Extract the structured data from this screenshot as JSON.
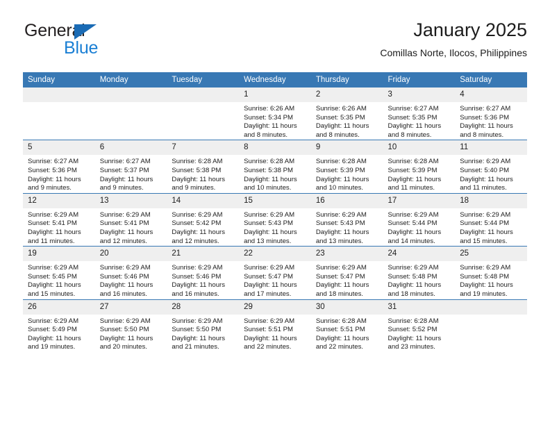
{
  "brand": {
    "name_top": "General",
    "name_bottom": "Blue",
    "triangle_icon": "triangle-icon",
    "color_dark": "#231f20",
    "color_blue": "#1a7fd4"
  },
  "header": {
    "title": "January 2025",
    "subtitle": "Comillas Norte, Ilocos, Philippines"
  },
  "theme": {
    "header_bg": "#3878b4",
    "header_text": "#ffffff",
    "daynum_bg": "#efefef",
    "cell_border": "#3878b4"
  },
  "calendar": {
    "weekdays": [
      "Sunday",
      "Monday",
      "Tuesday",
      "Wednesday",
      "Thursday",
      "Friday",
      "Saturday"
    ],
    "weeks": [
      [
        {
          "day": "",
          "sunrise": "",
          "sunset": "",
          "daylight": "",
          "empty": true
        },
        {
          "day": "",
          "sunrise": "",
          "sunset": "",
          "daylight": "",
          "empty": true
        },
        {
          "day": "",
          "sunrise": "",
          "sunset": "",
          "daylight": "",
          "empty": true
        },
        {
          "day": "1",
          "sunrise": "Sunrise: 6:26 AM",
          "sunset": "Sunset: 5:34 PM",
          "daylight": "Daylight: 11 hours and 8 minutes.",
          "empty": false
        },
        {
          "day": "2",
          "sunrise": "Sunrise: 6:26 AM",
          "sunset": "Sunset: 5:35 PM",
          "daylight": "Daylight: 11 hours and 8 minutes.",
          "empty": false
        },
        {
          "day": "3",
          "sunrise": "Sunrise: 6:27 AM",
          "sunset": "Sunset: 5:35 PM",
          "daylight": "Daylight: 11 hours and 8 minutes.",
          "empty": false
        },
        {
          "day": "4",
          "sunrise": "Sunrise: 6:27 AM",
          "sunset": "Sunset: 5:36 PM",
          "daylight": "Daylight: 11 hours and 8 minutes.",
          "empty": false
        }
      ],
      [
        {
          "day": "5",
          "sunrise": "Sunrise: 6:27 AM",
          "sunset": "Sunset: 5:36 PM",
          "daylight": "Daylight: 11 hours and 9 minutes.",
          "empty": false
        },
        {
          "day": "6",
          "sunrise": "Sunrise: 6:27 AM",
          "sunset": "Sunset: 5:37 PM",
          "daylight": "Daylight: 11 hours and 9 minutes.",
          "empty": false
        },
        {
          "day": "7",
          "sunrise": "Sunrise: 6:28 AM",
          "sunset": "Sunset: 5:38 PM",
          "daylight": "Daylight: 11 hours and 9 minutes.",
          "empty": false
        },
        {
          "day": "8",
          "sunrise": "Sunrise: 6:28 AM",
          "sunset": "Sunset: 5:38 PM",
          "daylight": "Daylight: 11 hours and 10 minutes.",
          "empty": false
        },
        {
          "day": "9",
          "sunrise": "Sunrise: 6:28 AM",
          "sunset": "Sunset: 5:39 PM",
          "daylight": "Daylight: 11 hours and 10 minutes.",
          "empty": false
        },
        {
          "day": "10",
          "sunrise": "Sunrise: 6:28 AM",
          "sunset": "Sunset: 5:39 PM",
          "daylight": "Daylight: 11 hours and 11 minutes.",
          "empty": false
        },
        {
          "day": "11",
          "sunrise": "Sunrise: 6:29 AM",
          "sunset": "Sunset: 5:40 PM",
          "daylight": "Daylight: 11 hours and 11 minutes.",
          "empty": false
        }
      ],
      [
        {
          "day": "12",
          "sunrise": "Sunrise: 6:29 AM",
          "sunset": "Sunset: 5:41 PM",
          "daylight": "Daylight: 11 hours and 11 minutes.",
          "empty": false
        },
        {
          "day": "13",
          "sunrise": "Sunrise: 6:29 AM",
          "sunset": "Sunset: 5:41 PM",
          "daylight": "Daylight: 11 hours and 12 minutes.",
          "empty": false
        },
        {
          "day": "14",
          "sunrise": "Sunrise: 6:29 AM",
          "sunset": "Sunset: 5:42 PM",
          "daylight": "Daylight: 11 hours and 12 minutes.",
          "empty": false
        },
        {
          "day": "15",
          "sunrise": "Sunrise: 6:29 AM",
          "sunset": "Sunset: 5:43 PM",
          "daylight": "Daylight: 11 hours and 13 minutes.",
          "empty": false
        },
        {
          "day": "16",
          "sunrise": "Sunrise: 6:29 AM",
          "sunset": "Sunset: 5:43 PM",
          "daylight": "Daylight: 11 hours and 13 minutes.",
          "empty": false
        },
        {
          "day": "17",
          "sunrise": "Sunrise: 6:29 AM",
          "sunset": "Sunset: 5:44 PM",
          "daylight": "Daylight: 11 hours and 14 minutes.",
          "empty": false
        },
        {
          "day": "18",
          "sunrise": "Sunrise: 6:29 AM",
          "sunset": "Sunset: 5:44 PM",
          "daylight": "Daylight: 11 hours and 15 minutes.",
          "empty": false
        }
      ],
      [
        {
          "day": "19",
          "sunrise": "Sunrise: 6:29 AM",
          "sunset": "Sunset: 5:45 PM",
          "daylight": "Daylight: 11 hours and 15 minutes.",
          "empty": false
        },
        {
          "day": "20",
          "sunrise": "Sunrise: 6:29 AM",
          "sunset": "Sunset: 5:46 PM",
          "daylight": "Daylight: 11 hours and 16 minutes.",
          "empty": false
        },
        {
          "day": "21",
          "sunrise": "Sunrise: 6:29 AM",
          "sunset": "Sunset: 5:46 PM",
          "daylight": "Daylight: 11 hours and 16 minutes.",
          "empty": false
        },
        {
          "day": "22",
          "sunrise": "Sunrise: 6:29 AM",
          "sunset": "Sunset: 5:47 PM",
          "daylight": "Daylight: 11 hours and 17 minutes.",
          "empty": false
        },
        {
          "day": "23",
          "sunrise": "Sunrise: 6:29 AM",
          "sunset": "Sunset: 5:47 PM",
          "daylight": "Daylight: 11 hours and 18 minutes.",
          "empty": false
        },
        {
          "day": "24",
          "sunrise": "Sunrise: 6:29 AM",
          "sunset": "Sunset: 5:48 PM",
          "daylight": "Daylight: 11 hours and 18 minutes.",
          "empty": false
        },
        {
          "day": "25",
          "sunrise": "Sunrise: 6:29 AM",
          "sunset": "Sunset: 5:48 PM",
          "daylight": "Daylight: 11 hours and 19 minutes.",
          "empty": false
        }
      ],
      [
        {
          "day": "26",
          "sunrise": "Sunrise: 6:29 AM",
          "sunset": "Sunset: 5:49 PM",
          "daylight": "Daylight: 11 hours and 19 minutes.",
          "empty": false
        },
        {
          "day": "27",
          "sunrise": "Sunrise: 6:29 AM",
          "sunset": "Sunset: 5:50 PM",
          "daylight": "Daylight: 11 hours and 20 minutes.",
          "empty": false
        },
        {
          "day": "28",
          "sunrise": "Sunrise: 6:29 AM",
          "sunset": "Sunset: 5:50 PM",
          "daylight": "Daylight: 11 hours and 21 minutes.",
          "empty": false
        },
        {
          "day": "29",
          "sunrise": "Sunrise: 6:29 AM",
          "sunset": "Sunset: 5:51 PM",
          "daylight": "Daylight: 11 hours and 22 minutes.",
          "empty": false
        },
        {
          "day": "30",
          "sunrise": "Sunrise: 6:28 AM",
          "sunset": "Sunset: 5:51 PM",
          "daylight": "Daylight: 11 hours and 22 minutes.",
          "empty": false
        },
        {
          "day": "31",
          "sunrise": "Sunrise: 6:28 AM",
          "sunset": "Sunset: 5:52 PM",
          "daylight": "Daylight: 11 hours and 23 minutes.",
          "empty": false
        },
        {
          "day": "",
          "sunrise": "",
          "sunset": "",
          "daylight": "",
          "empty": true
        }
      ]
    ]
  }
}
